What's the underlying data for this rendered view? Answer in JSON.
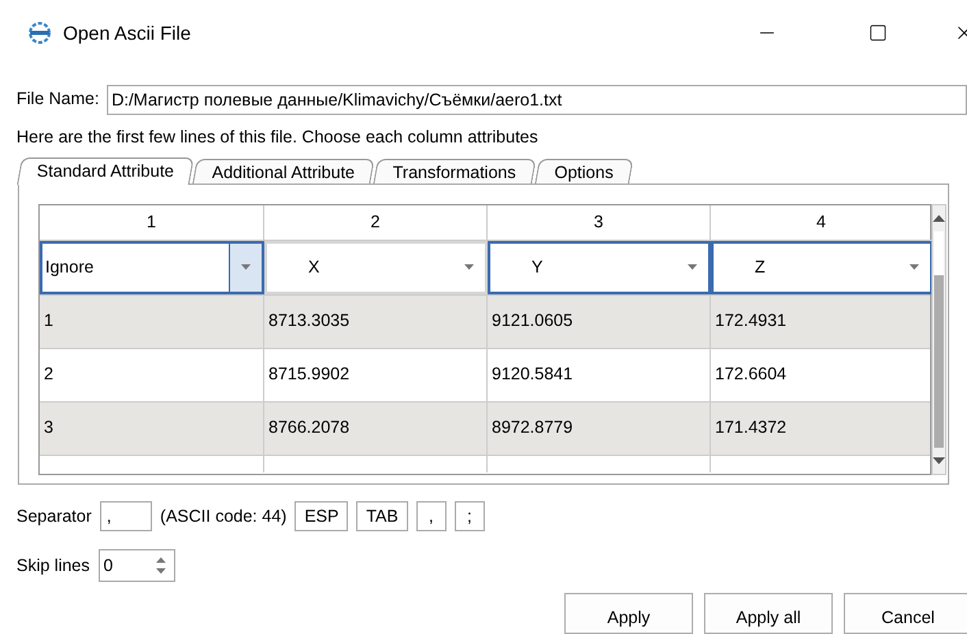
{
  "window": {
    "title": "Open Ascii File"
  },
  "file_name": {
    "label": "File Name:",
    "value": "D:/Магистр полевые данные/Klimavichy/Съёмки/aero1.txt"
  },
  "hint": "Here are the first few lines of this file. Choose each column attributes",
  "tabs": [
    {
      "label": "Standard Attribute",
      "selected": true
    },
    {
      "label": "Additional Attribute",
      "selected": false
    },
    {
      "label": "Transformations",
      "selected": false
    },
    {
      "label": "Options",
      "selected": false
    }
  ],
  "table": {
    "columns": [
      "1",
      "2",
      "3",
      "4"
    ],
    "attributes": [
      {
        "value": "Ignore",
        "focused": true,
        "hovered": true
      },
      {
        "value": "X",
        "focused": false,
        "hovered": false
      },
      {
        "value": "Y",
        "focused": true,
        "hovered": false
      },
      {
        "value": "Z",
        "focused": true,
        "hovered": false
      }
    ],
    "rows": [
      [
        "1",
        "8713.3035",
        "9121.0605",
        "172.4931"
      ],
      [
        "2",
        "8715.9902",
        "9120.5841",
        "172.6604"
      ],
      [
        "3",
        "8766.2078",
        "8972.8779",
        "171.4372"
      ]
    ]
  },
  "separator": {
    "label": "Separator",
    "value": ",",
    "ascii": "(ASCII code: 44)",
    "buttons": [
      "ESP",
      "TAB",
      ",",
      ";"
    ]
  },
  "skip_lines": {
    "label": "Skip lines",
    "value": "0"
  },
  "buttons": [
    "Apply",
    "Apply all",
    "Cancel"
  ]
}
